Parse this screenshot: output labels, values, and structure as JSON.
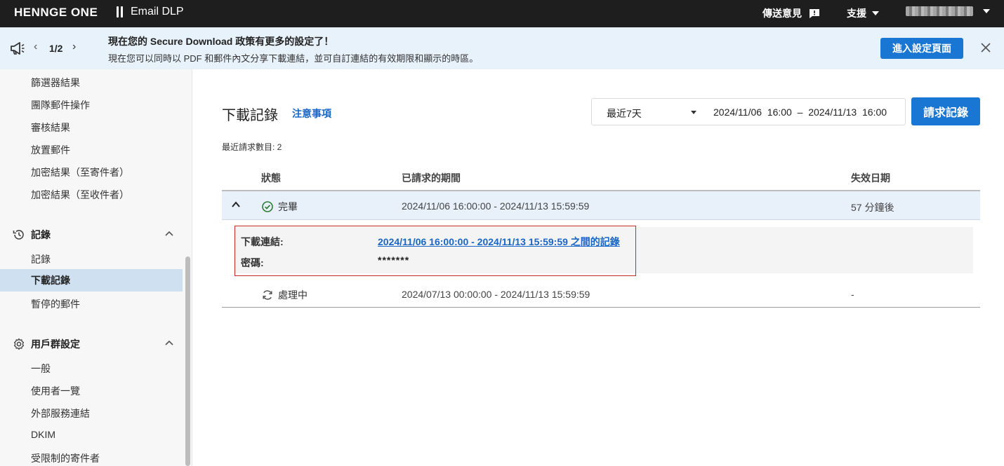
{
  "topbar": {
    "brand": "HENNGE ONE",
    "product": "Email DLP",
    "feedback": "傳送意見",
    "support": "支援"
  },
  "banner": {
    "pager": "1/2",
    "title": "現在您的 Secure Download 政策有更多的設定了！",
    "description": "現在您可以同時以 PDF 和郵件內文分享下載連結，並可自訂連結的有效期限和顯示的時區。",
    "button": "進入設定頁面"
  },
  "sidebar": {
    "top_items": [
      "篩選器結果",
      "團隊郵件操作",
      "審核結果",
      "放置郵件",
      "加密結果（至寄件者）",
      "加密結果（至收件者）"
    ],
    "logs_section": "記錄",
    "logs_items": [
      "記錄",
      "下載記錄",
      "暫停的郵件"
    ],
    "group_section": "用戶群設定",
    "group_items": [
      "一般",
      "使用者一覽",
      "外部服務連結",
      "DKIM",
      "受限制的寄件者"
    ]
  },
  "main": {
    "title": "下載記錄",
    "notes_link": "注意事項",
    "period_select": "最近7天",
    "range_text": "2024/11/06  16:00  –  2024/11/13  16:00",
    "request_button": "請求記錄",
    "count_text": "最近請求數目: 2",
    "columns": [
      "狀態",
      "已請求的期間",
      "失效日期"
    ],
    "rows": [
      {
        "status": "完畢",
        "period": "2024/11/06 16:00:00 - 2024/11/13 15:59:59",
        "expiry": "57 分鐘後"
      },
      {
        "status": "處理中",
        "period": "2024/07/13 00:00:00 - 2024/11/13 15:59:59",
        "expiry": "-"
      }
    ],
    "detail": {
      "link_label": "下載連結:",
      "link_text": "2024/11/06 16:00:00 - 2024/11/13 15:59:59 之間的記錄",
      "password_label": "密碼:",
      "password_value": "*******"
    }
  },
  "colors": {
    "accent": "#1976d2",
    "success": "#2e7d32",
    "highlight_border": "#c62828"
  }
}
